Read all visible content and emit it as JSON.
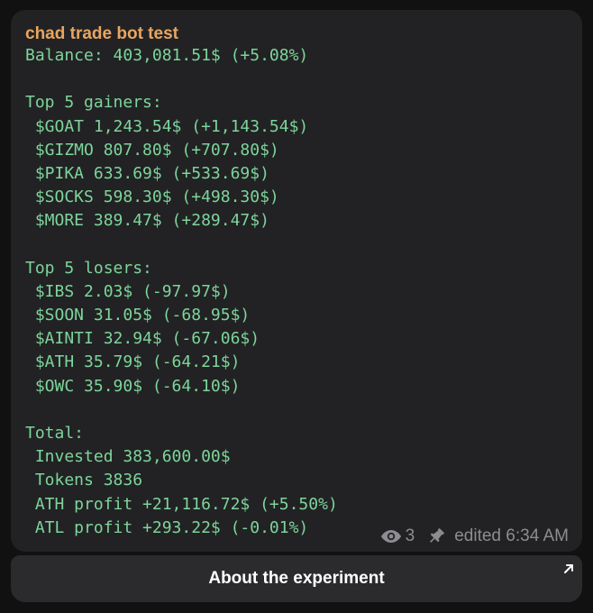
{
  "message": {
    "sender": "chad trade bot test",
    "lines": [
      "Balance: 403,081.51$ (+5.08%)",
      "",
      "Top 5 gainers:",
      " $GOAT 1,243.54$ (+1,143.54$)",
      " $GIZMO 807.80$ (+707.80$)",
      " $PIKA 633.69$ (+533.69$)",
      " $SOCKS 598.30$ (+498.30$)",
      " $MORE 389.47$ (+289.47$)",
      "",
      "Top 5 losers:",
      " $IBS 2.03$ (-97.97$)",
      " $SOON 31.05$ (-68.95$)",
      " $AINTI 32.94$ (-67.06$)",
      " $ATH 35.79$ (-64.21$)",
      " $OWC 35.90$ (-64.10$)",
      "",
      "Total:",
      " Invested 383,600.00$",
      " Tokens 3836",
      " ATH profit +21,116.72$ (+5.50%)",
      " ATL profit +293.22$ (-0.01%)"
    ],
    "views": "3",
    "edited": "edited 6:34 AM",
    "icons": {
      "views": "eye-icon",
      "pinned": "pin-icon"
    }
  },
  "inline_button": {
    "label": "About the experiment",
    "icon": "external-link-arrow-icon"
  },
  "colors": {
    "background": "#111112",
    "bubble": "#222224",
    "sender": "#e8a561",
    "message_text": "#7dd59b",
    "meta_text": "#8d8d91",
    "button_bg": "#2b2b2d",
    "button_text": "#ffffff"
  }
}
